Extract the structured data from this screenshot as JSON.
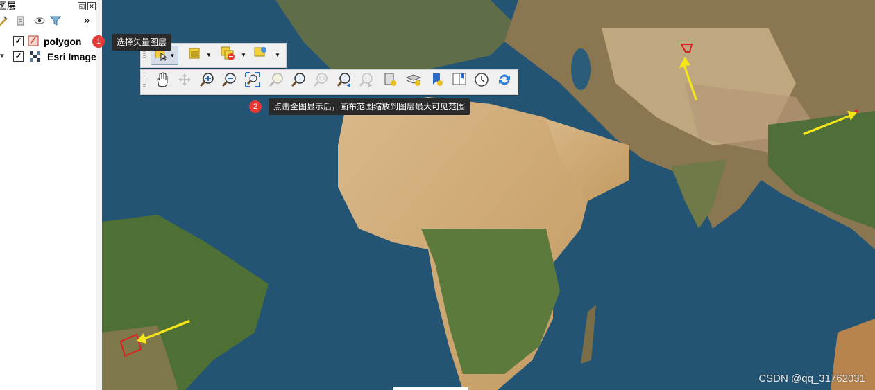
{
  "panel": {
    "title": "图层",
    "float_btn": "◱",
    "close_btn": "✕",
    "more_btn": "»",
    "layers": [
      {
        "name": "polygon",
        "checked": true,
        "icon": "vector-polygon-icon"
      },
      {
        "name": "Esri Image",
        "checked": true,
        "icon": "raster-icon"
      }
    ]
  },
  "toolbars": {
    "selection": [
      "select-features-icon",
      "attribute-table-icon",
      "deselect-icon",
      "select-by-location-icon"
    ],
    "navigation": [
      "pan-icon",
      "pan-to-selection-icon",
      "zoom-in-icon",
      "zoom-out-icon",
      "zoom-full-icon",
      "zoom-selection-icon",
      "zoom-layer-icon",
      "zoom-native-icon",
      "zoom-last-icon",
      "zoom-next-icon",
      "new-bookmark-icon",
      "show-bookmarks-icon",
      "new-spatial-bookmark-icon",
      "show-spatial-bookmarks-icon",
      "temporal-icon",
      "refresh-icon"
    ]
  },
  "annotations": [
    {
      "num": "1",
      "text": "选择矢量图层"
    },
    {
      "num": "2",
      "text": "点击全图显示后，画布范围缩放到图层最大可见范围"
    }
  ],
  "watermark": "CSDN @qq_31762031",
  "colors": {
    "accent": "#e53935",
    "arrow": "#f5e61a",
    "polygon": "#e02020",
    "ocean": "#1f4e6e"
  }
}
